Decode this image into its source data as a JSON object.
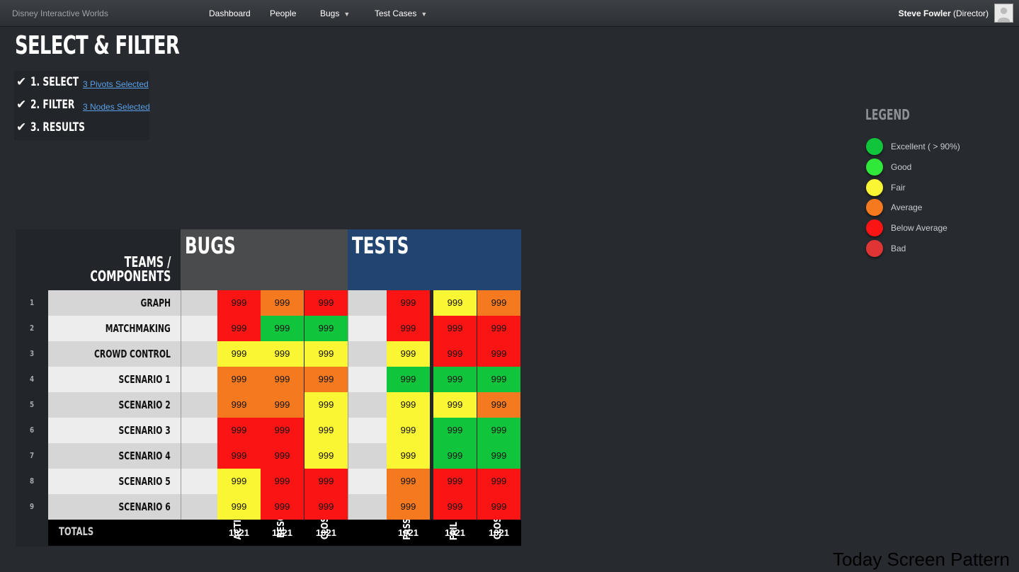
{
  "topbar": {
    "brand": "Disney Interactive Worlds",
    "nav": [
      {
        "label": "Dashboard",
        "has_caret": false
      },
      {
        "label": "People",
        "has_caret": false
      },
      {
        "label": "Bugs",
        "has_caret": true
      },
      {
        "label": "Test Cases",
        "has_caret": true
      }
    ],
    "user_name": "Steve Fowler",
    "user_role": "(Director)",
    "avatar_icon": "user-silhouette-icon"
  },
  "page_title": "SELECT & FILTER",
  "steps": [
    {
      "label": "1. SELECT",
      "link": "3 Pivots Selected",
      "icon": "checkmark-icon"
    },
    {
      "label": "2. FILTER",
      "link": "3 Nodes Selected",
      "icon": "checkmark-icon"
    },
    {
      "label": "3. RESULTS",
      "link": "",
      "icon": "checkmark-icon"
    }
  ],
  "legend": {
    "title": "LEGEND",
    "items": [
      {
        "label": "Excellent ( > 90%)",
        "color": "#10c43c"
      },
      {
        "label": "Good",
        "color": "#2fe83a"
      },
      {
        "label": "Fair",
        "color": "#fbf633"
      },
      {
        "label": "Average",
        "color": "#f57a1f"
      },
      {
        "label": "Below Average",
        "color": "#fb1414"
      },
      {
        "label": "Bad",
        "color": "#e03535"
      }
    ]
  },
  "grid": {
    "teams_title_line1": "TEAMS /",
    "teams_title_line2": "COMPONENTS",
    "bugs_title": "BUGS",
    "tests_title": "TESTS",
    "bugs_columns": [
      "ACTIVE",
      "RESOLVED",
      "CLOSED"
    ],
    "tests_columns": [
      "PASS",
      "FAIL",
      "CLOSED"
    ],
    "rows": [
      {
        "num": "1",
        "name": "GRAPH",
        "bugs": [
          {
            "v": "999",
            "c": "#fb1414"
          },
          {
            "v": "999",
            "c": "#f57a1f"
          },
          {
            "v": "999",
            "c": "#fb1414"
          }
        ],
        "tests": [
          {
            "v": "999",
            "c": "#fb1414"
          },
          {
            "v": "999",
            "c": "#fbf633"
          },
          {
            "v": "999",
            "c": "#f57a1f"
          }
        ]
      },
      {
        "num": "2",
        "name": "MATCHMAKING",
        "bugs": [
          {
            "v": "999",
            "c": "#fb1414"
          },
          {
            "v": "999",
            "c": "#10c43c"
          },
          {
            "v": "999",
            "c": "#10c43c"
          }
        ],
        "tests": [
          {
            "v": "999",
            "c": "#fb1414"
          },
          {
            "v": "999",
            "c": "#fb1414"
          },
          {
            "v": "999",
            "c": "#fb1414"
          }
        ]
      },
      {
        "num": "3",
        "name": "CROWD CONTROL",
        "bugs": [
          {
            "v": "999",
            "c": "#fbf633"
          },
          {
            "v": "999",
            "c": "#fbf633"
          },
          {
            "v": "999",
            "c": "#fbf633"
          }
        ],
        "tests": [
          {
            "v": "999",
            "c": "#fbf633"
          },
          {
            "v": "999",
            "c": "#fb1414"
          },
          {
            "v": "999",
            "c": "#fb1414"
          }
        ]
      },
      {
        "num": "4",
        "name": "SCENARIO 1",
        "bugs": [
          {
            "v": "999",
            "c": "#f57a1f"
          },
          {
            "v": "999",
            "c": "#f57a1f"
          },
          {
            "v": "999",
            "c": "#f57a1f"
          }
        ],
        "tests": [
          {
            "v": "999",
            "c": "#10c43c"
          },
          {
            "v": "999",
            "c": "#10c43c"
          },
          {
            "v": "999",
            "c": "#10c43c"
          }
        ]
      },
      {
        "num": "5",
        "name": "SCENARIO 2",
        "bugs": [
          {
            "v": "999",
            "c": "#f57a1f"
          },
          {
            "v": "999",
            "c": "#f57a1f"
          },
          {
            "v": "999",
            "c": "#fbf633"
          }
        ],
        "tests": [
          {
            "v": "999",
            "c": "#fbf633"
          },
          {
            "v": "999",
            "c": "#fbf633"
          },
          {
            "v": "999",
            "c": "#f57a1f"
          }
        ]
      },
      {
        "num": "6",
        "name": "SCENARIO 3",
        "bugs": [
          {
            "v": "999",
            "c": "#fb1414"
          },
          {
            "v": "999",
            "c": "#fb1414"
          },
          {
            "v": "999",
            "c": "#fbf633"
          }
        ],
        "tests": [
          {
            "v": "999",
            "c": "#fbf633"
          },
          {
            "v": "999",
            "c": "#10c43c"
          },
          {
            "v": "999",
            "c": "#10c43c"
          }
        ]
      },
      {
        "num": "7",
        "name": "SCENARIO 4",
        "bugs": [
          {
            "v": "999",
            "c": "#fb1414"
          },
          {
            "v": "999",
            "c": "#fb1414"
          },
          {
            "v": "999",
            "c": "#fbf633"
          }
        ],
        "tests": [
          {
            "v": "999",
            "c": "#fbf633"
          },
          {
            "v": "999",
            "c": "#10c43c"
          },
          {
            "v": "999",
            "c": "#10c43c"
          }
        ]
      },
      {
        "num": "8",
        "name": "SCENARIO 5",
        "bugs": [
          {
            "v": "999",
            "c": "#fbf633"
          },
          {
            "v": "999",
            "c": "#fb1414"
          },
          {
            "v": "999",
            "c": "#fb1414"
          }
        ],
        "tests": [
          {
            "v": "999",
            "c": "#f57a1f"
          },
          {
            "v": "999",
            "c": "#fb1414"
          },
          {
            "v": "999",
            "c": "#fb1414"
          }
        ]
      },
      {
        "num": "9",
        "name": "SCENARIO 6",
        "bugs": [
          {
            "v": "999",
            "c": "#fbf633"
          },
          {
            "v": "999",
            "c": "#fb1414"
          },
          {
            "v": "999",
            "c": "#fb1414"
          }
        ],
        "tests": [
          {
            "v": "999",
            "c": "#f57a1f"
          },
          {
            "v": "999",
            "c": "#fb1414"
          },
          {
            "v": "999",
            "c": "#fb1414"
          }
        ]
      }
    ],
    "totals_label": "TOTALS",
    "totals_bugs": [
      "1021",
      "1021",
      "1021"
    ],
    "totals_tests": [
      "1021",
      "1021",
      "1021"
    ]
  },
  "caption": "Today Screen Pattern"
}
